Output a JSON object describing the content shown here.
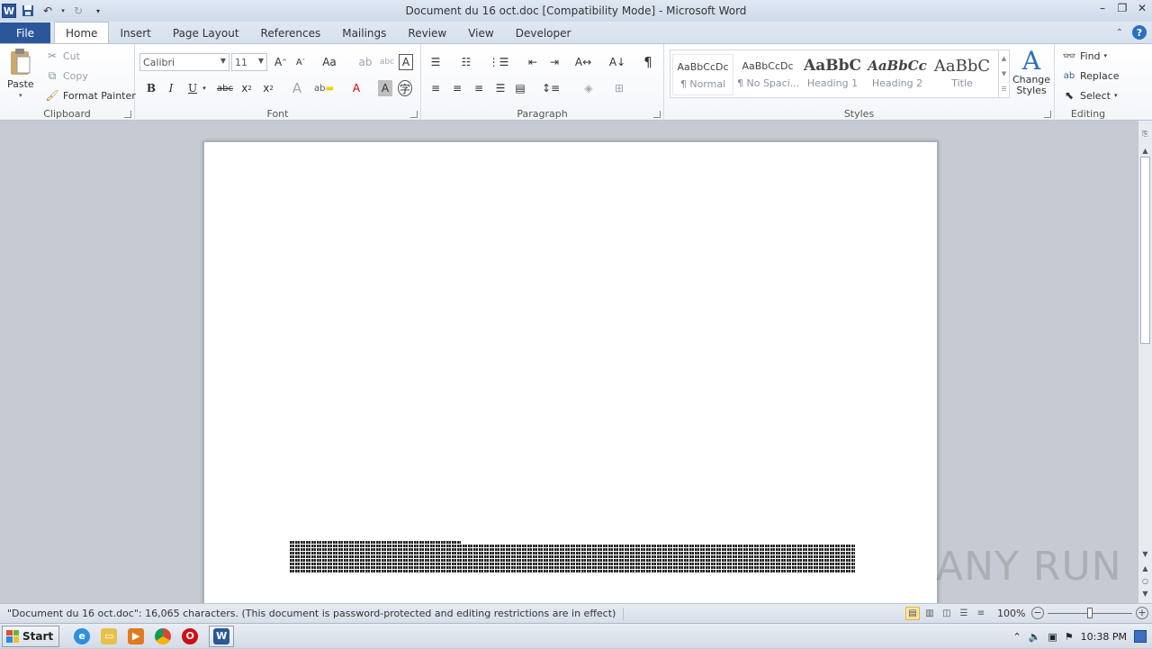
{
  "window": {
    "title": "Document du 16 oct.doc [Compatibility Mode]  -  Microsoft Word",
    "controls": [
      "–",
      "❐",
      "✕"
    ]
  },
  "qat": {
    "app_icon": "W"
  },
  "tabs": {
    "file": "File",
    "items": [
      "Home",
      "Insert",
      "Page Layout",
      "References",
      "Mailings",
      "Review",
      "View",
      "Developer"
    ]
  },
  "clipboard": {
    "paste": "Paste",
    "cut": "Cut",
    "copy": "Copy",
    "format_painter": "Format Painter",
    "label": "Clipboard"
  },
  "font": {
    "name": "Calibri",
    "size": "11",
    "label": "Font"
  },
  "paragraph": {
    "label": "Paragraph"
  },
  "styles": {
    "label": "Styles",
    "items": [
      {
        "sample": "AaBbCcDc",
        "name": "¶ Normal"
      },
      {
        "sample": "AaBbCcDc",
        "name": "¶ No Spaci..."
      },
      {
        "sample": "AaBbC",
        "name": "Heading 1"
      },
      {
        "sample": "AaBbCc",
        "name": "Heading 2"
      },
      {
        "sample": "AaBbC",
        "name": "Title"
      }
    ],
    "change_styles": "Change Styles"
  },
  "editing": {
    "find": "Find",
    "replace": "Replace",
    "select": "Select",
    "label": "Editing"
  },
  "watermark": "ANY RUN",
  "status": {
    "text": "\"Document du 16 oct.doc\": 16,065 characters.  (This document is password-protected and editing restrictions are in effect)",
    "zoom": "100%",
    "zoom_level_percent": 100
  },
  "taskbar": {
    "start": "Start",
    "clock": "10:38 PM"
  }
}
